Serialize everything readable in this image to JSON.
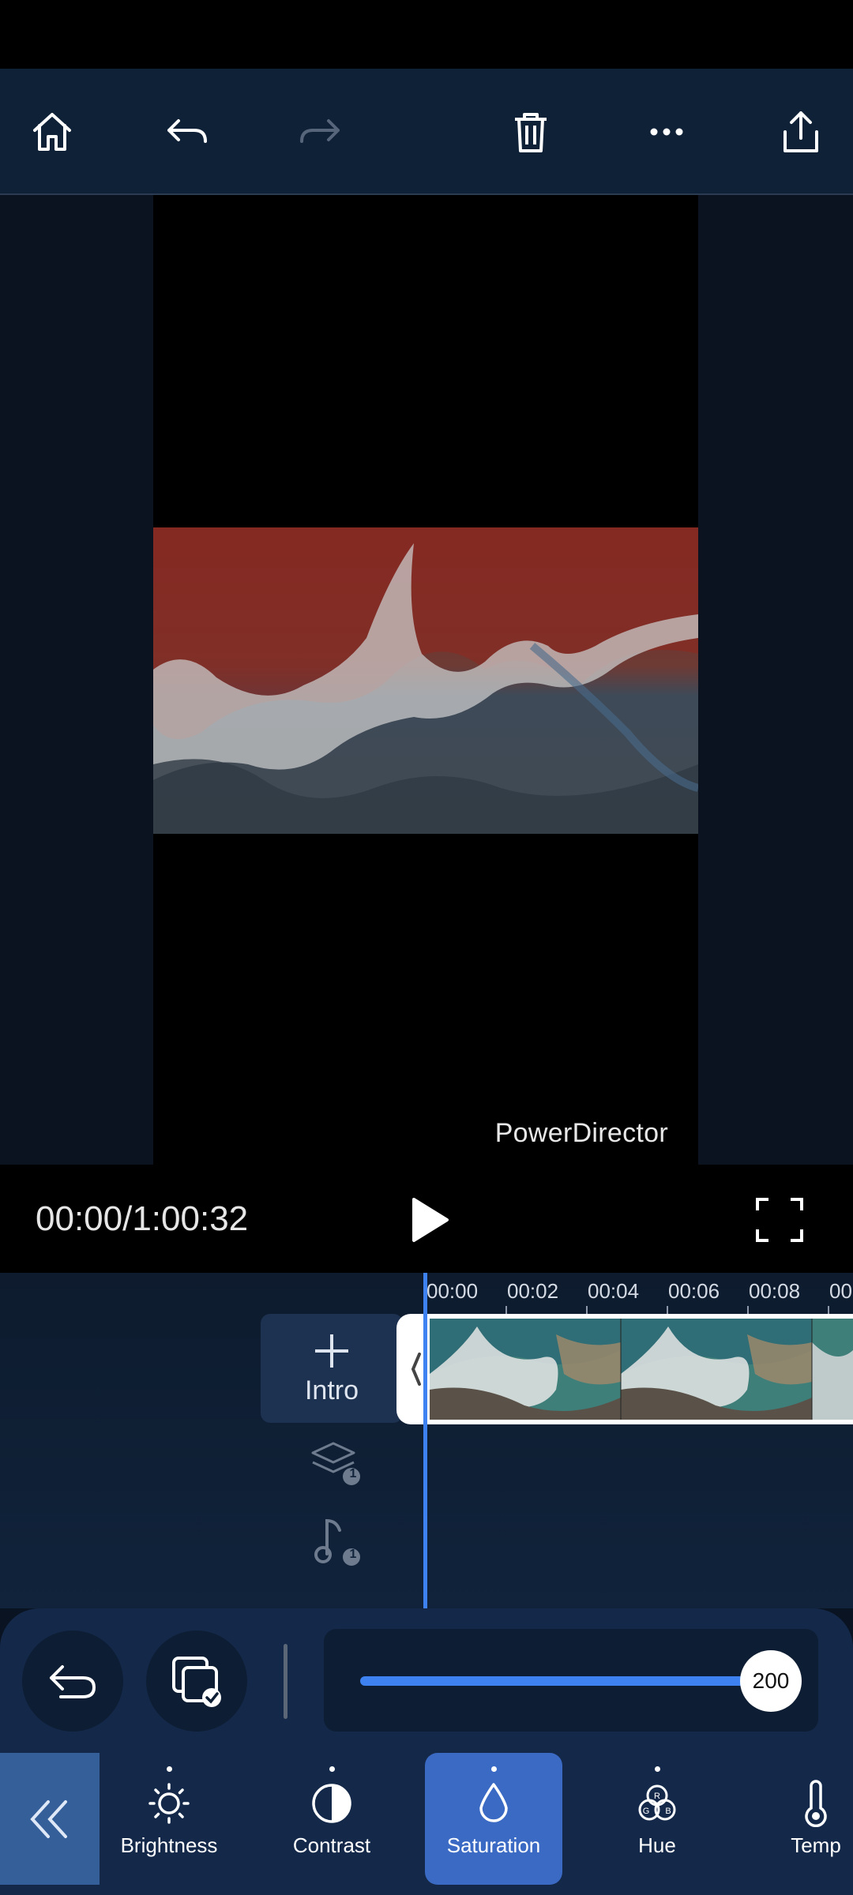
{
  "app": {
    "watermark": "PowerDirector"
  },
  "toolbar": {
    "icons": [
      "home-icon",
      "undo-icon",
      "redo-icon",
      "trash-icon",
      "more-icon",
      "export-icon"
    ]
  },
  "playback": {
    "timecode": "00:00/1:00:32"
  },
  "timeline": {
    "ticks": [
      "00:00",
      "00:02",
      "00:04",
      "00:06",
      "00:08",
      "00"
    ],
    "intro_label": "Intro",
    "overlay_badge": "1",
    "audio_badge": "1"
  },
  "adjust": {
    "slider_value": "200",
    "slider_fraction": 1.0
  },
  "tabs": [
    {
      "label": "Brightness",
      "icon": "sun-icon"
    },
    {
      "label": "Contrast",
      "icon": "contrast-icon"
    },
    {
      "label": "Saturation",
      "icon": "droplet-icon",
      "active": true
    },
    {
      "label": "Hue",
      "icon": "rgb-icon"
    },
    {
      "label": "Temp",
      "icon": "thermometer-icon"
    }
  ],
  "colors": {
    "accent": "#3d82f0",
    "active_tab": "#3a6ac4",
    "panel": "#14294a"
  }
}
